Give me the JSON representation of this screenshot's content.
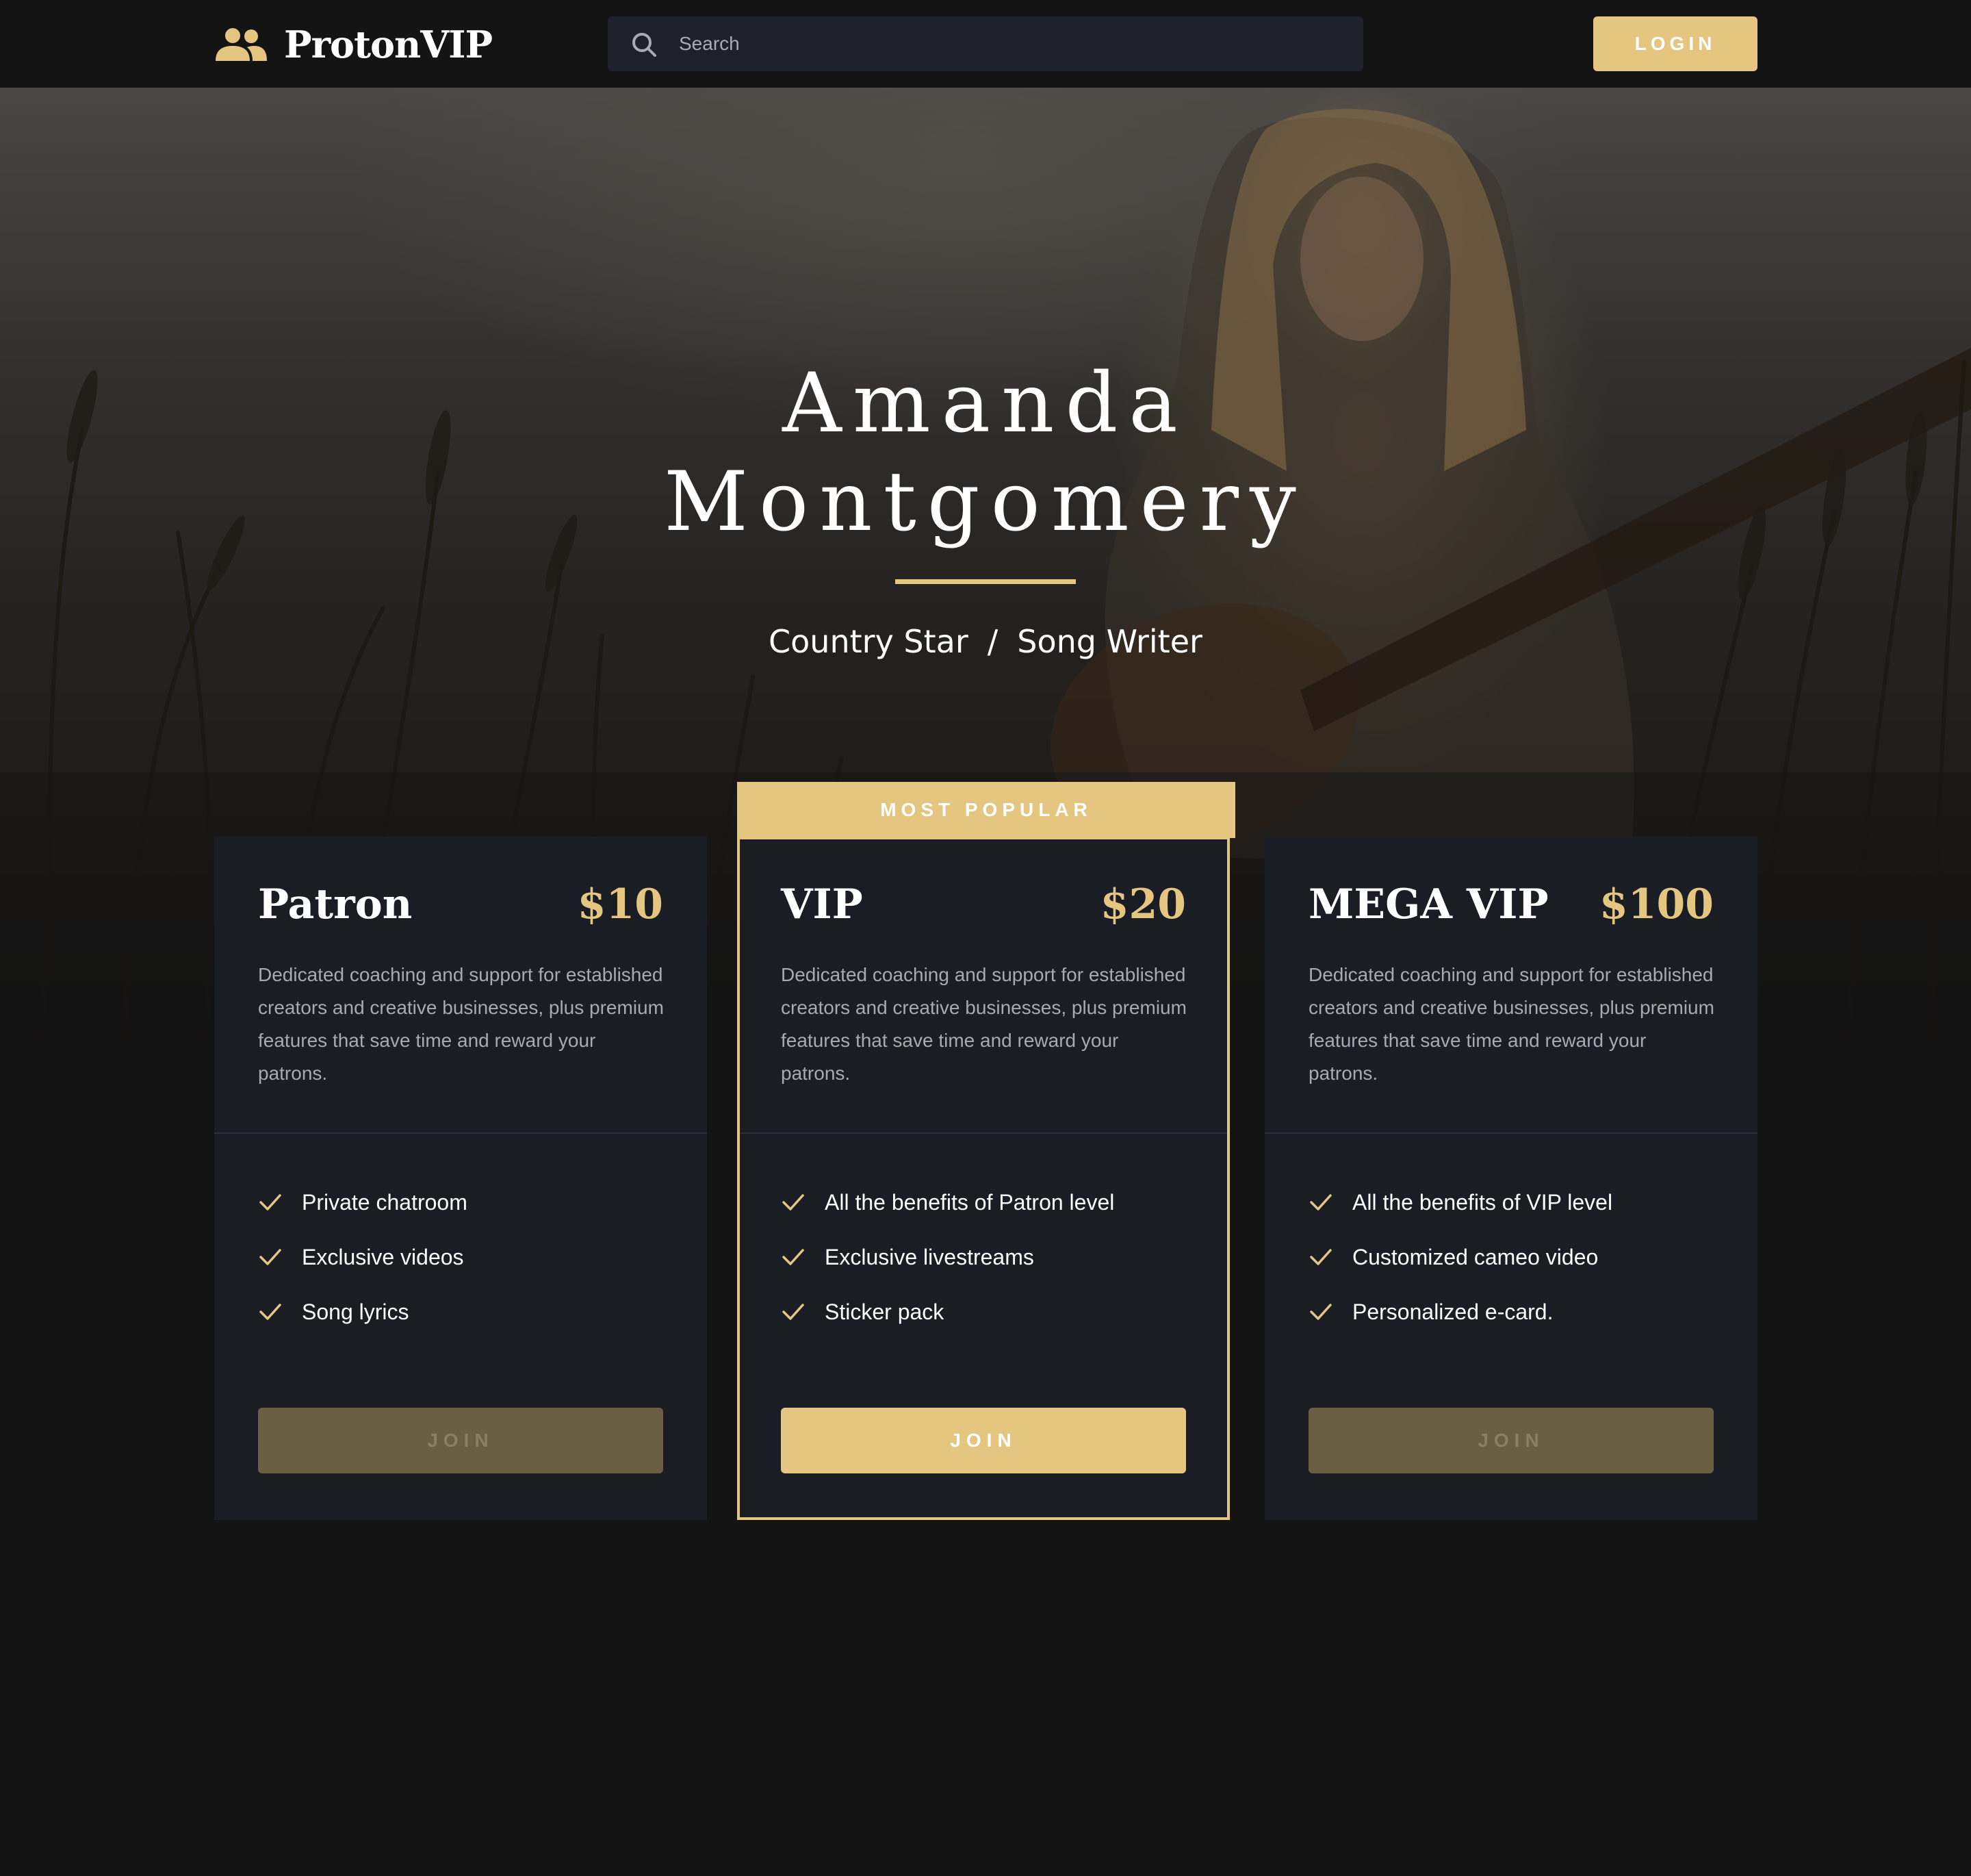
{
  "header": {
    "brand_name": "ProtonVIP",
    "brand_icon": "people-group-icon",
    "search": {
      "placeholder": "Search",
      "value": "",
      "icon": "search-icon"
    },
    "login_label": "LOGIN"
  },
  "hero": {
    "title_line1": "Amanda",
    "title_line2": "Montgomery",
    "subtitle_part1": "Country Star",
    "subtitle_separator": "/",
    "subtitle_part2": "Song Writer"
  },
  "plans": [
    {
      "name": "Patron",
      "price": "$10",
      "description": "Dedicated coaching and support for established creators and creative businesses, plus premium features that save time and reward your patrons.",
      "features": [
        "Private chatroom",
        "Exclusive videos",
        "Song lyrics"
      ],
      "join_label": "JOIN"
    },
    {
      "badge": "MOST POPULAR",
      "name": "VIP",
      "price": "$20",
      "description": "Dedicated coaching and support for established creators and creative businesses, plus premium features that save time and reward your patrons.",
      "features": [
        "All the benefits of Patron level",
        "Exclusive livestreams",
        "Sticker pack"
      ],
      "join_label": "JOIN"
    },
    {
      "name": "MEGA VIP",
      "price": "$100",
      "description": "Dedicated coaching and support for established creators and creative businesses, plus premium features that save time and reward your patrons.",
      "features": [
        "All the benefits of VIP level",
        "Customized cameo video",
        "Personalized e-card."
      ],
      "join_label": "JOIN"
    }
  ],
  "colors": {
    "accent": "#e4c681",
    "background": "#141414",
    "card": "#1b1d24",
    "muted_button": "#6b5f43",
    "body_text": "#a7aab1"
  }
}
